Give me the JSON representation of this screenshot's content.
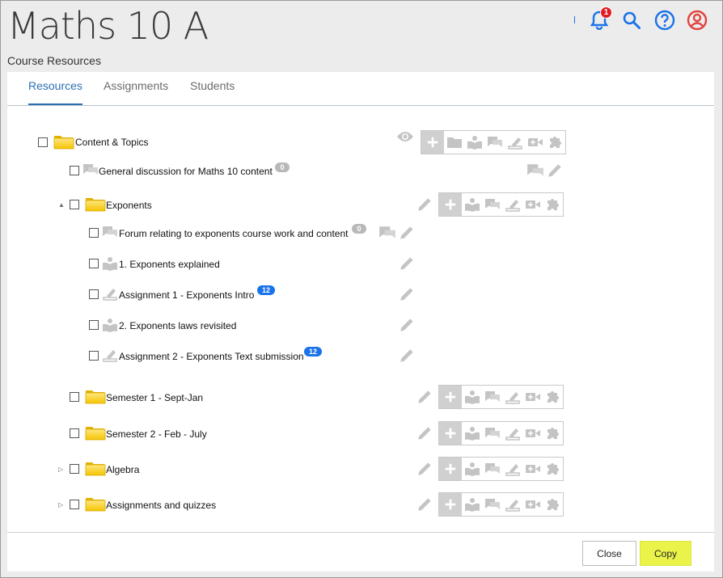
{
  "header": {
    "title": "Maths 10 A",
    "subtitle": "Course Resources",
    "notifications_count": "1",
    "icons": [
      "bell-icon",
      "search-icon",
      "help-icon",
      "user-icon"
    ],
    "accent": "#1a73e8"
  },
  "tabs": [
    {
      "label": "Resources",
      "active": true
    },
    {
      "label": "Assignments",
      "active": false
    },
    {
      "label": "Students",
      "active": false
    }
  ],
  "tree": {
    "content_topics": {
      "label": "Content & Topics"
    },
    "general_discussion": {
      "label": "General discussion for Maths 10 content",
      "count": "0"
    },
    "exponents": {
      "label": "Exponents",
      "expanded": true
    },
    "forum_exponents": {
      "label": "Forum relating to exponents course work and content",
      "count": "0"
    },
    "exponents_explained": {
      "label": "1. Exponents explained"
    },
    "assignment1": {
      "label": "Assignment 1 - Exponents Intro",
      "count": "12"
    },
    "laws_revisited": {
      "label": "2. Exponents laws revisited"
    },
    "assignment2": {
      "label": "Assignment 2 - Exponents Text submission",
      "count": "12"
    },
    "semester1": {
      "label": "Semester 1 - Sept-Jan"
    },
    "semester2": {
      "label": "Semester 2 - Feb - July"
    },
    "algebra": {
      "label": "Algebra",
      "expanded": false
    },
    "assignments_quizzes": {
      "label": "Assignments and quizzes",
      "expanded": false
    }
  },
  "footer": {
    "close_label": "Close",
    "copy_label": "Copy",
    "copy_color": "#eaf34a"
  }
}
